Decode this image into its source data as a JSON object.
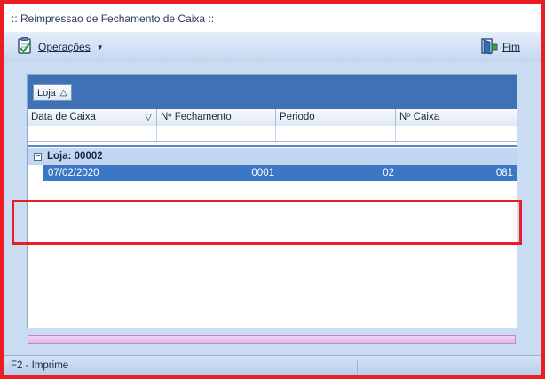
{
  "window": {
    "title": ":: Reimpressao de Fechamento de Caixa ::"
  },
  "toolbar": {
    "operations_label": "Operações",
    "operations_icon": "document-check-icon",
    "exit_label": "Fim",
    "exit_icon": "exit-door-icon"
  },
  "grid": {
    "group_by_button": "Loja",
    "group_sort_indicator": "△",
    "columns": [
      {
        "label": "Data de Caixa",
        "filter_indicator": "▽"
      },
      {
        "label": "Nº Fechamento"
      },
      {
        "label": "Periodo"
      },
      {
        "label": "Nº Caixa"
      }
    ],
    "group": {
      "expand_symbol": "−",
      "label": "Loja: 00002",
      "rows": [
        {
          "data_de_caixa": "07/02/2020",
          "n_fechamento": "0001",
          "periodo": "02",
          "n_caixa": "081"
        }
      ]
    }
  },
  "status_bar": {
    "text": "F2 - Imprime"
  },
  "colors": {
    "highlight_border": "#ec1c24",
    "group_panel": "#3f71b7",
    "selected_row": "#3c77c6",
    "window_background": "#c9dcf2"
  }
}
